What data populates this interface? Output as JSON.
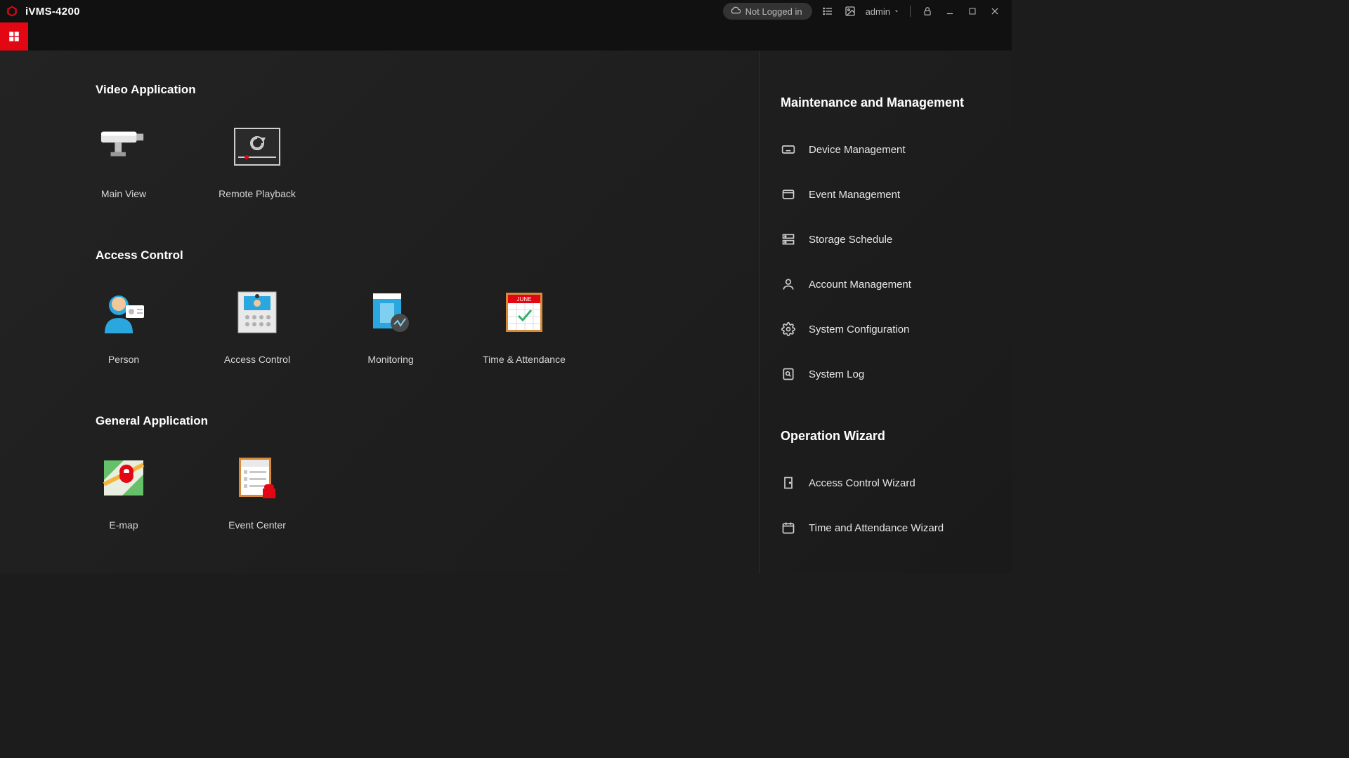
{
  "app": {
    "title": "iVMS-4200"
  },
  "titlebar": {
    "login_status": "Not Logged in",
    "user": "admin"
  },
  "sections": {
    "video": {
      "title": "Video Application",
      "tiles": [
        {
          "label": "Main View"
        },
        {
          "label": "Remote Playback"
        }
      ]
    },
    "access": {
      "title": "Access Control",
      "tiles": [
        {
          "label": "Person"
        },
        {
          "label": "Access Control"
        },
        {
          "label": "Monitoring"
        },
        {
          "label": "Time & Attendance"
        }
      ]
    },
    "general": {
      "title": "General Application",
      "tiles": [
        {
          "label": "E-map"
        },
        {
          "label": "Event Center"
        }
      ]
    }
  },
  "right": {
    "maint_title": "Maintenance and Management",
    "maint": [
      "Device Management",
      "Event Management",
      "Storage Schedule",
      "Account Management",
      "System Configuration",
      "System Log"
    ],
    "wizard_title": "Operation Wizard",
    "wizard": [
      "Access Control Wizard",
      "Time and Attendance Wizard"
    ]
  }
}
